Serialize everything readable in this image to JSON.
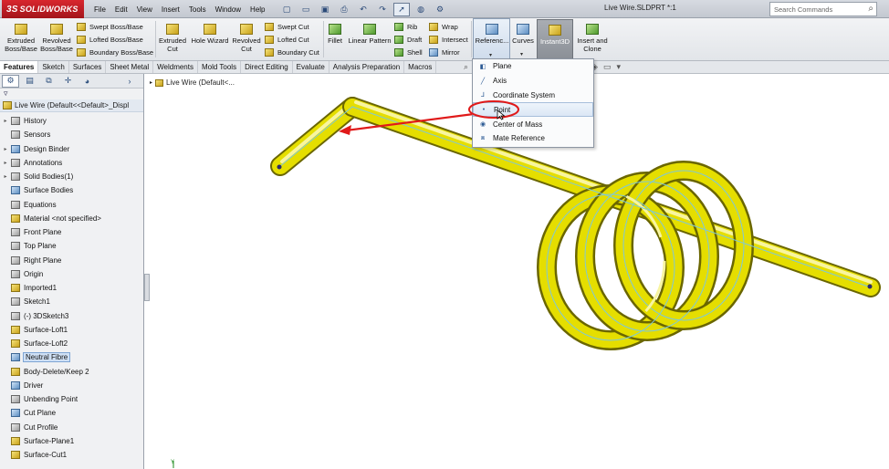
{
  "app": {
    "brand": "SOLIDWORKS",
    "brand_mark": "3S",
    "document_title": "Live Wire.SLDPRT *:1"
  },
  "menubar": [
    "File",
    "Edit",
    "View",
    "Insert",
    "Tools",
    "Window",
    "Help"
  ],
  "search": {
    "placeholder": "Search Commands"
  },
  "command_manager": {
    "extruded_boss": "Extruded Boss/Base",
    "revolved_boss": "Revolved Boss/Base",
    "swept_boss": "Swept Boss/Base",
    "lofted_boss": "Lofted Boss/Base",
    "boundary_boss": "Boundary Boss/Base",
    "extruded_cut": "Extruded Cut",
    "hole_wizard": "Hole Wizard",
    "revolved_cut": "Revolved Cut",
    "swept_cut": "Swept Cut",
    "lofted_cut": "Lofted Cut",
    "boundary_cut": "Boundary Cut",
    "fillet": "Fillet",
    "linear_pattern": "Linear Pattern",
    "rib": "Rib",
    "draft": "Draft",
    "shell": "Shell",
    "wrap": "Wrap",
    "intersect": "Intersect",
    "mirror": "Mirror",
    "reference": "Referenc...",
    "curves": "Curves",
    "instant3d": "Instant3D",
    "insert_clone": "Insert and Clone"
  },
  "tabs": [
    "Features",
    "Sketch",
    "Surfaces",
    "Sheet Metal",
    "Weldments",
    "Mold Tools",
    "Direct Editing",
    "Evaluate",
    "Analysis Preparation",
    "Macros"
  ],
  "active_tab": "Features",
  "reference_menu": [
    "Plane",
    "Axis",
    "Coordinate System",
    "Point",
    "Center of Mass",
    "Mate Reference"
  ],
  "highlighted_menu_item": "Point",
  "feature_tree": {
    "root": "Live Wire  (Default<<Default>_Displ",
    "items": [
      {
        "label": "History",
        "expandable": true
      },
      {
        "label": "Sensors",
        "expandable": false
      },
      {
        "label": "Design Binder",
        "expandable": true
      },
      {
        "label": "Annotations",
        "expandable": true
      },
      {
        "label": "Solid Bodies(1)",
        "expandable": true
      },
      {
        "label": "Surface Bodies",
        "expandable": false
      },
      {
        "label": "Equations",
        "expandable": false
      },
      {
        "label": "Material <not specified>",
        "expandable": false
      },
      {
        "label": "Front Plane",
        "expandable": false
      },
      {
        "label": "Top Plane",
        "expandable": false
      },
      {
        "label": "Right Plane",
        "expandable": false
      },
      {
        "label": "Origin",
        "expandable": false
      },
      {
        "label": "Imported1",
        "expandable": false
      },
      {
        "label": "Sketch1",
        "expandable": false
      },
      {
        "label": "(-) 3DSketch3",
        "expandable": false
      },
      {
        "label": "Surface-Loft1",
        "expandable": false
      },
      {
        "label": "Surface-Loft2",
        "expandable": false
      },
      {
        "label": "Neutral Fibre",
        "expandable": false,
        "selected": true
      },
      {
        "label": "Body-Delete/Keep 2",
        "expandable": false
      },
      {
        "label": "Driver",
        "expandable": false
      },
      {
        "label": "Unbending Point",
        "expandable": false
      },
      {
        "label": "Cut Plane",
        "expandable": false
      },
      {
        "label": "Cut Profile",
        "expandable": false
      },
      {
        "label": "Surface-Plane1",
        "expandable": false
      },
      {
        "label": "Surface-Cut1",
        "expandable": false
      }
    ]
  },
  "viewport": {
    "tree_label": "Live Wire  (Default<..."
  },
  "colors": {
    "part_yellow": "#e8e000",
    "neutral_fibre_line": "#7fc8d8",
    "annotation_red": "#e01a1a",
    "selection_blue": "#cfe0f5"
  }
}
